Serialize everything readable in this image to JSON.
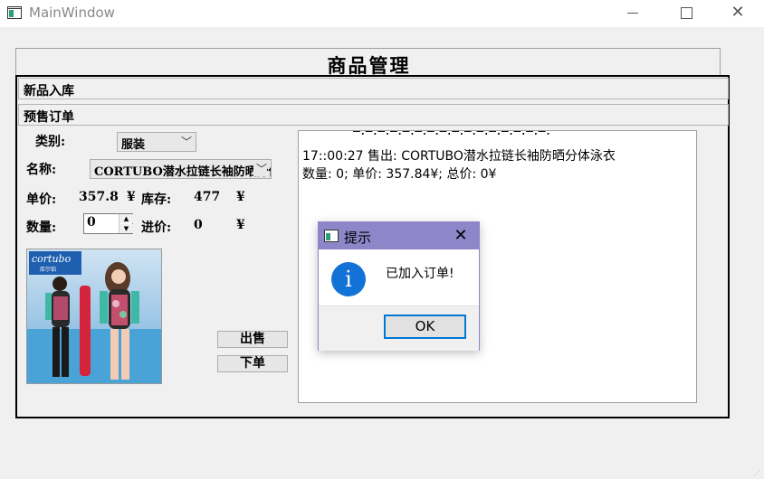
{
  "window": {
    "title": "MainWindow"
  },
  "header": {
    "title": "商品管理"
  },
  "sections": {
    "new_stock": "新品入库",
    "presale": "预售订单"
  },
  "form": {
    "category_label": "类别:",
    "category_value": "服装",
    "name_label": "名称:",
    "name_value": "CORTUBO潜水拉链长袖防晒分体泳衣",
    "price_label": "单价:",
    "price_value": "357.8",
    "currency": "¥",
    "stock_label": "库存:",
    "stock_value": "477",
    "quantity_label": "数量:",
    "quantity_value": "0",
    "cost_label": "进价:",
    "cost_value": "0",
    "photo_brand": "cortubo",
    "photo_brand_sub": "库尔铂"
  },
  "buttons": {
    "sell": "出售",
    "order": "下单"
  },
  "log": {
    "lines": [
      "17::00:27 售出: CORTUBO潜水拉链长袖防晒分体泳衣",
      "数量: 0; 单价: 357.84¥; 总价: 0¥"
    ]
  },
  "dialog": {
    "title": "提示",
    "message": "已加入订单!",
    "ok_label": "OK",
    "info_glyph": "i"
  },
  "icons": {
    "minimize": "minimize-icon",
    "maximize": "maximize-icon",
    "close": "close-icon",
    "info": "info-icon"
  },
  "colors": {
    "dialog_title": "#8d86c9",
    "info_blue": "#1272d6",
    "ok_border": "#0078d7"
  }
}
